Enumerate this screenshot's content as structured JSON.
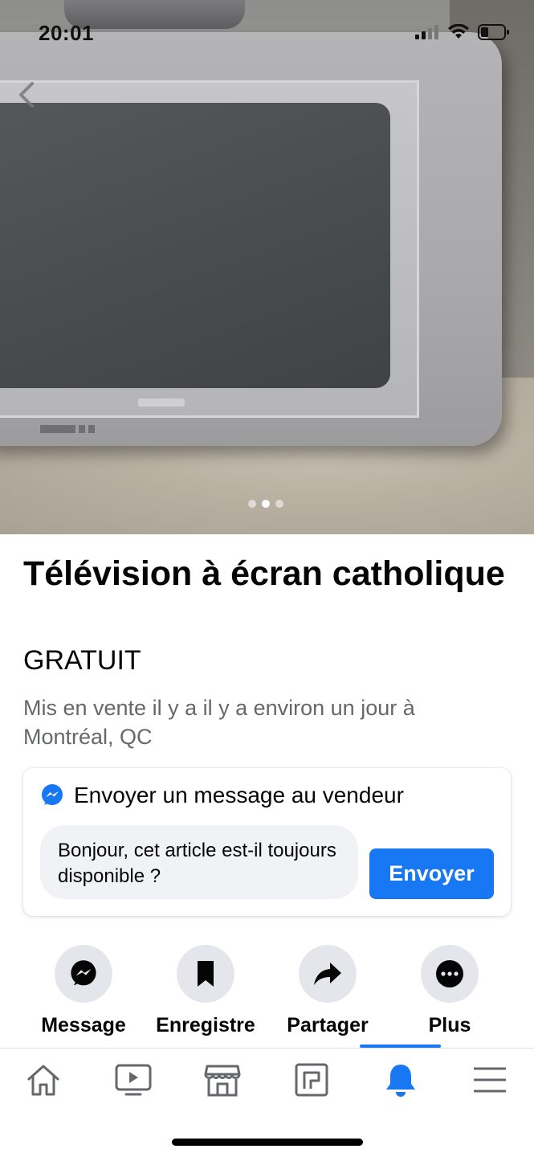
{
  "status_bar": {
    "time": "20:01"
  },
  "photo": {
    "page_indicator": {
      "total": 3,
      "active_index": 1
    }
  },
  "listing": {
    "title": "Télévision à écran catholique",
    "price": "GRATUIT",
    "meta": "Mis en vente il y a il y a environ un jour à Montréal, QC"
  },
  "message_card": {
    "header": "Envoyer un message au vendeur",
    "input_value": "Bonjour, cet article est-il toujours disponible ?",
    "send_label": "Envoyer"
  },
  "actions": [
    {
      "label": "Message",
      "icon": "messenger-icon"
    },
    {
      "label": "Enregistre",
      "icon": "bookmark-icon"
    },
    {
      "label": "Partager",
      "icon": "share-icon"
    },
    {
      "label": "Plus",
      "icon": "more-icon"
    }
  ],
  "tabbar": {
    "tabs": [
      "home-icon",
      "video-icon",
      "marketplace-icon",
      "feeds-icon",
      "notifications-icon",
      "menu-icon"
    ],
    "active": "notifications-icon"
  },
  "colors": {
    "accent": "#1877f2",
    "secondary_text": "#65676b",
    "chip_bg": "#e4e6eb",
    "input_bg": "#f0f2f5"
  }
}
